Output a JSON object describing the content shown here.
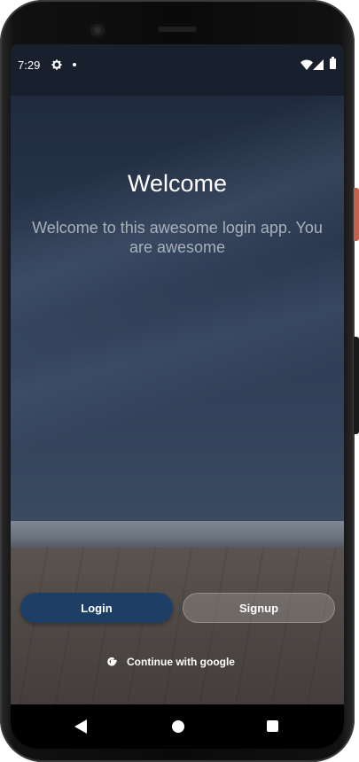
{
  "status_bar": {
    "time": "7:29",
    "icons": [
      "gear-icon",
      "notification-dot",
      "wifi-icon",
      "signal-icon",
      "battery-icon"
    ]
  },
  "welcome": {
    "title": "Welcome",
    "subtitle": "Welcome to this awesome login app. You are awesome"
  },
  "buttons": {
    "login_label": "Login",
    "signup_label": "Signup",
    "google_label": "Continue with  google"
  },
  "colors": {
    "login_button": "#1d3f66",
    "status_bar": "#18202d",
    "accent_side_button": "#c4614a"
  },
  "nav_bar": {
    "icons": [
      "back-icon",
      "home-icon",
      "recents-icon"
    ]
  }
}
